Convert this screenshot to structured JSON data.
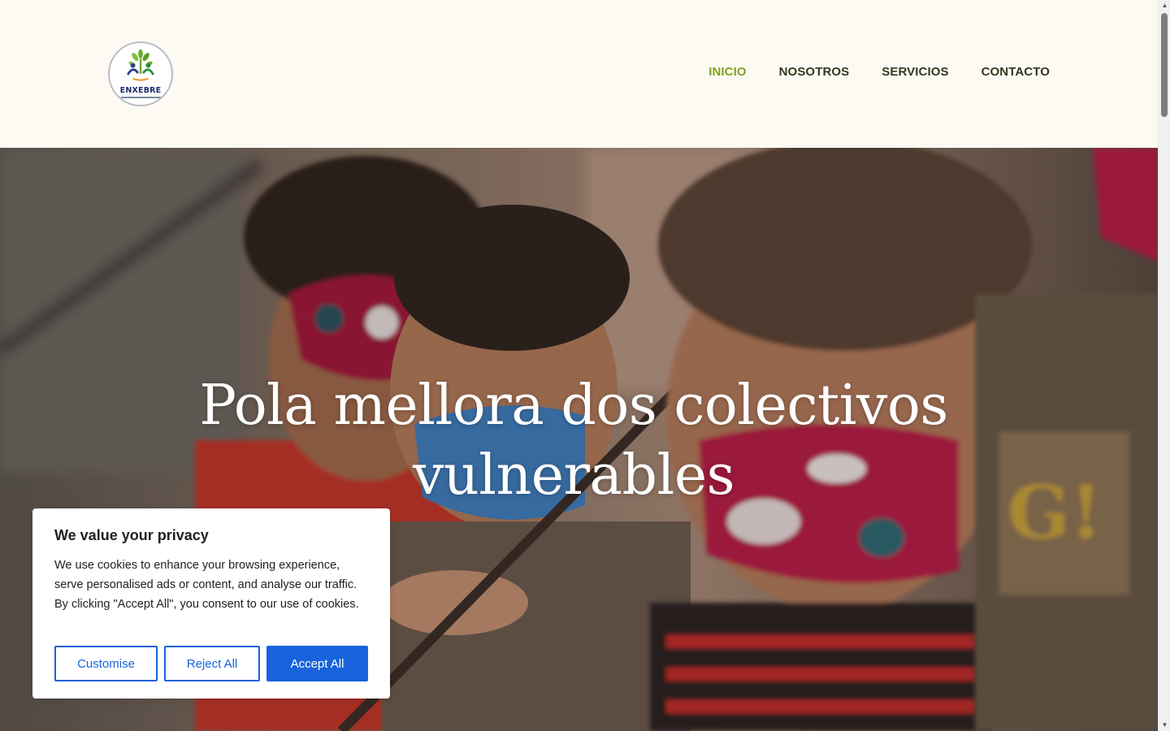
{
  "brand": {
    "logo_text": "ENXEBRE"
  },
  "nav": {
    "items": [
      {
        "label": "INICIO",
        "active": true
      },
      {
        "label": "NOSOTROS",
        "active": false
      },
      {
        "label": "SERVICIOS",
        "active": false
      },
      {
        "label": "CONTACTO",
        "active": false
      }
    ]
  },
  "hero": {
    "title_line1": "Pola mellora dos colectivos",
    "title_line2": "vulnerables"
  },
  "cookie": {
    "title": "We value your privacy",
    "text": "We use cookies to enhance your browsing experience, serve personalised ads or content, and analyse our traffic. By clicking \"Accept All\", you consent to our use of cookies.",
    "customise_label": "Customise",
    "reject_label": "Reject All",
    "accept_label": "Accept All"
  },
  "colors": {
    "header_bg": "#fcfaf3",
    "nav_text": "#33381f",
    "nav_active": "#7fa21e",
    "accent_blue": "#1863dc"
  }
}
